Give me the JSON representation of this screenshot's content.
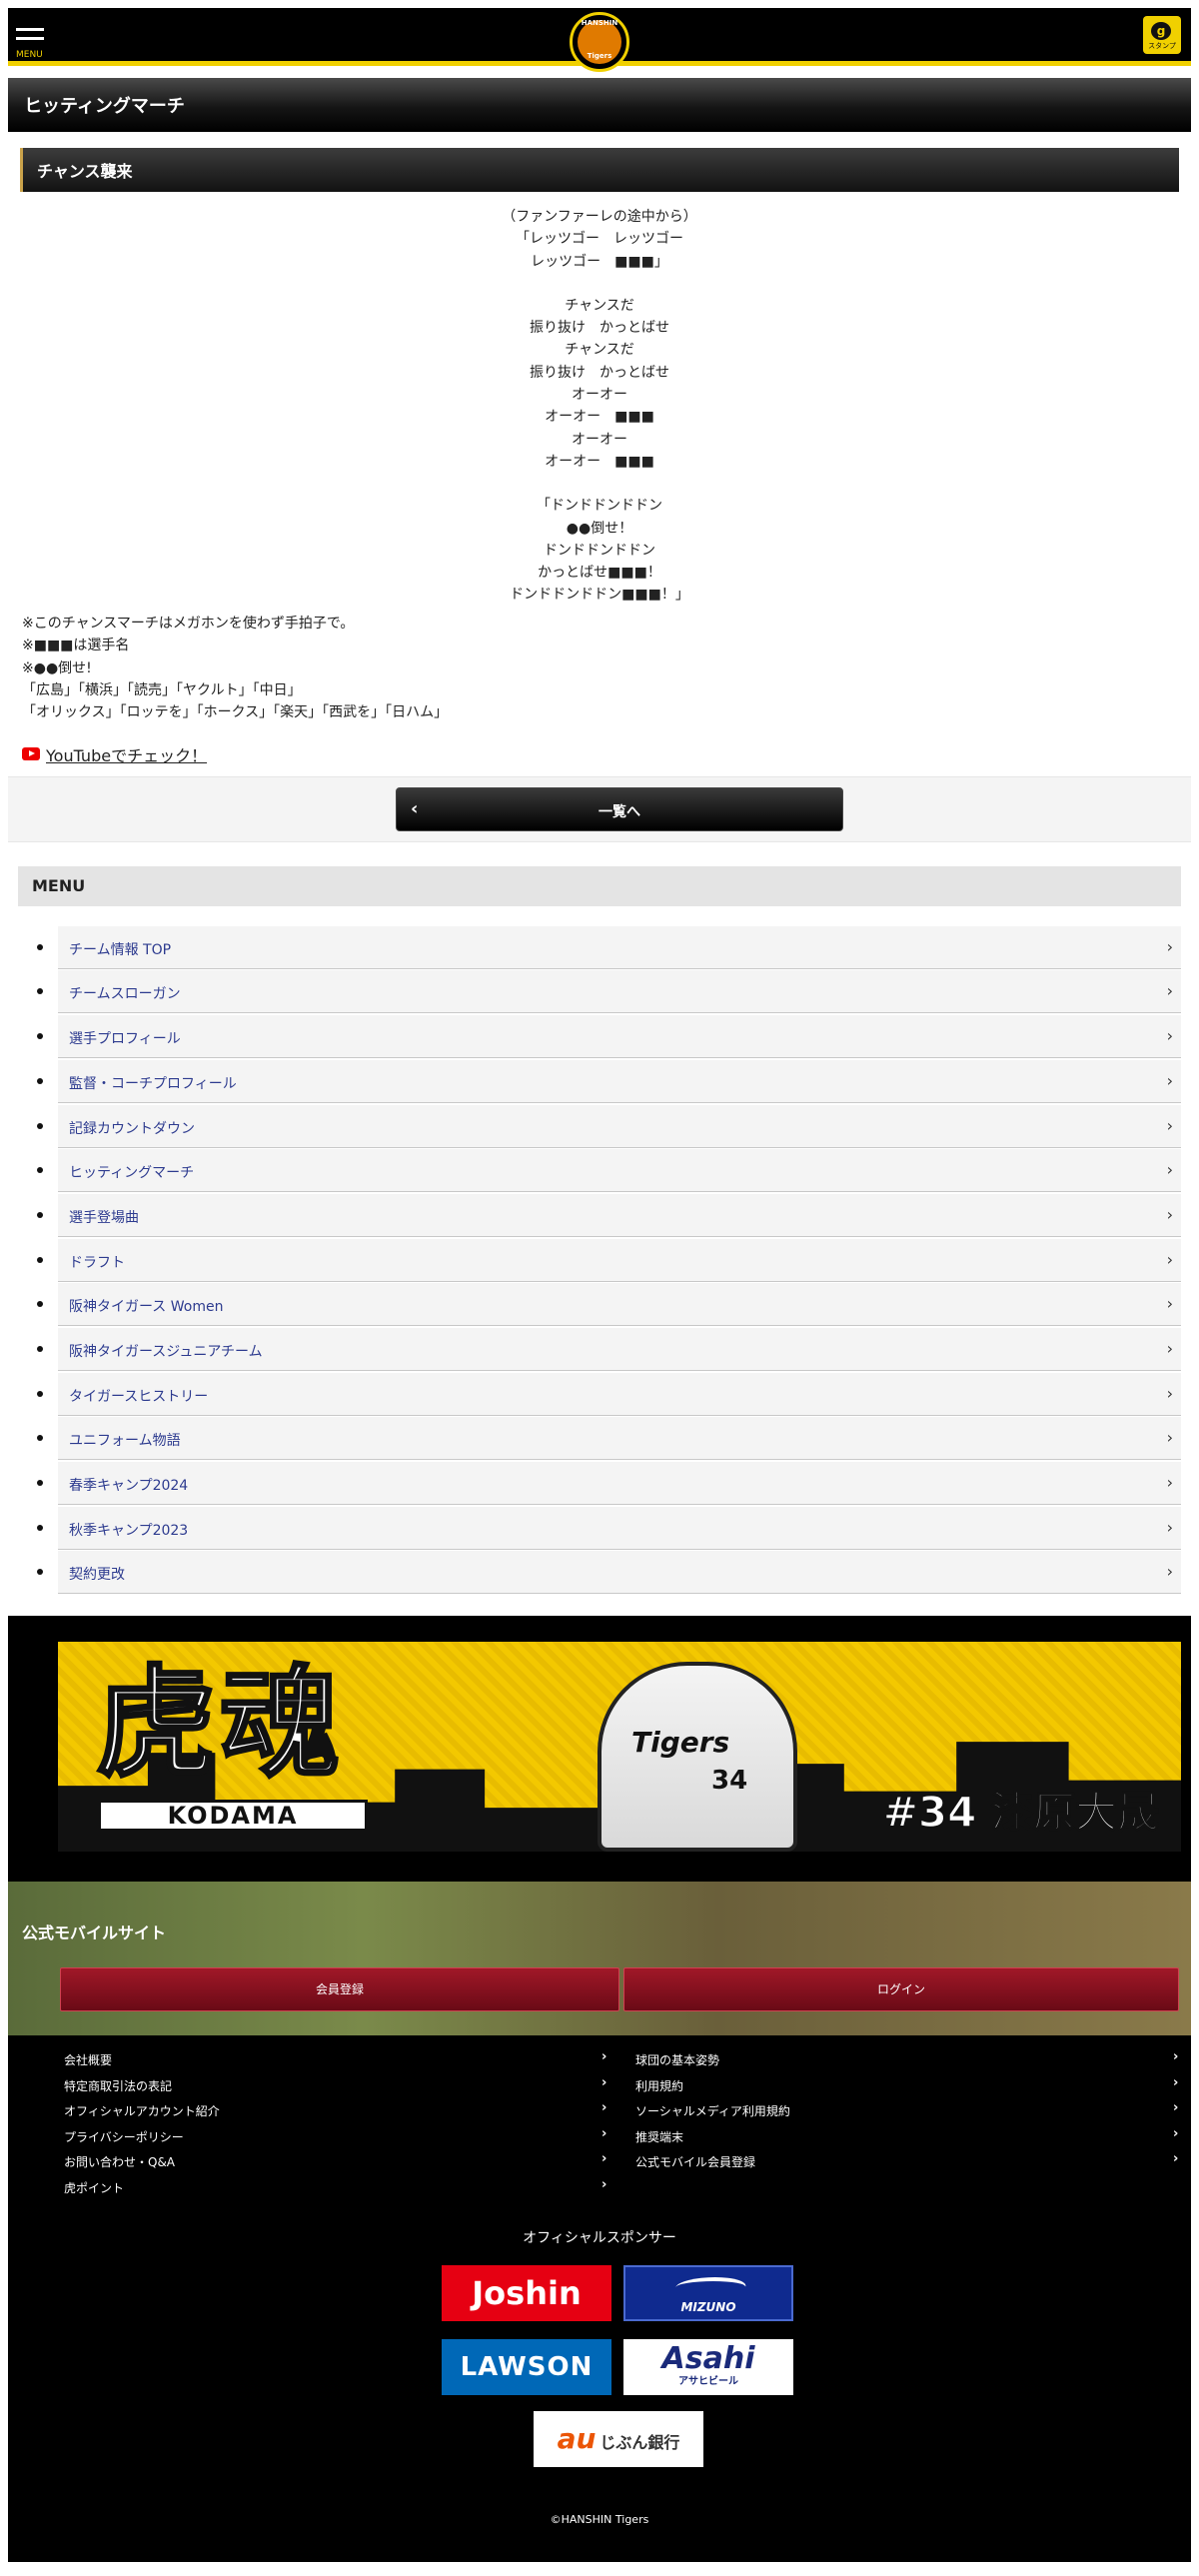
{
  "header": {
    "menu_label": "MENU",
    "logo_name": "HANSHIN",
    "logo_team": "Tigers",
    "stamp_label": "スタンプ"
  },
  "page_title": "ヒッティングマーチ",
  "section_title": "チャンス襲来",
  "lyrics": [
    "（ファンファーレの途中から）",
    "「レッツゴー　レッツゴー",
    "レッツゴー　■■■」",
    "",
    "チャンスだ",
    "振り抜け　かっとばせ",
    "チャンスだ",
    "振り抜け　かっとばせ",
    "オーオー",
    "オーオー　■■■",
    "オーオー",
    "オーオー　■■■",
    "",
    "「ドンドドンドドン",
    "●●倒せ！",
    "ドンドドンドドン",
    "かっとばせ■■■！",
    "ドンドドンドドン■■■！」"
  ],
  "notes": [
    "※このチャンスマーチはメガホンを使わず手拍子で。",
    "※■■■は選手名",
    "※●●倒せ!",
    "「広島」「横浜」「読売」「ヤクルト」「中日」",
    "「オリックス」「ロッテを」「ホークス」「楽天」「西武を」「日ハム」"
  ],
  "youtube_link": "YouTubeでチェック！",
  "back_button": "一覧へ",
  "menu_title": "MENU",
  "menu_items": [
    "チーム情報 TOP",
    "チームスローガン",
    "選手プロフィール",
    "監督・コーチプロフィール",
    "記録カウントダウン",
    "ヒッティングマーチ",
    "選手登場曲",
    "ドラフト",
    "阪神タイガース Women",
    "阪神タイガースジュニアチーム",
    "タイガースヒストリー",
    "ユニフォーム物語",
    "春季キャンプ2024",
    "秋季キャンプ2023",
    "契約更改"
  ],
  "banner": {
    "kanji": "虎魂",
    "kodama": "KODAMA",
    "jersey_text": "Tigers",
    "jersey_number": "34",
    "caption": "#34 漆原大晟"
  },
  "mobile": {
    "title": "公式モバイルサイト",
    "register": "会員登録",
    "login": "ログイン"
  },
  "footer_links_left": [
    "会社概要",
    "特定商取引法の表記",
    "オフィシャルアカウント紹介",
    "プライバシーポリシー",
    "お問い合わせ・Q&A",
    "虎ポイント"
  ],
  "footer_links_right": [
    "球団の基本姿勢",
    "利用規約",
    "ソーシャルメディア利用規約",
    "推奨端末",
    "公式モバイル会員登録"
  ],
  "sponsors": {
    "title": "オフィシャルスポンサー",
    "joshin": "Joshin",
    "mizuno": "MIZUNO",
    "lawson": "LAWSON",
    "asahi": "Asahi",
    "asahi_sub": "アサヒビール",
    "jibun_au": "au",
    "jibun": "じぶん銀行"
  },
  "copyright": "©HANSHIN Tigers",
  "colors": {
    "brand_yellow": "#f0d000",
    "menu_link": "#2d3b8f",
    "button_red": "#a01828"
  }
}
